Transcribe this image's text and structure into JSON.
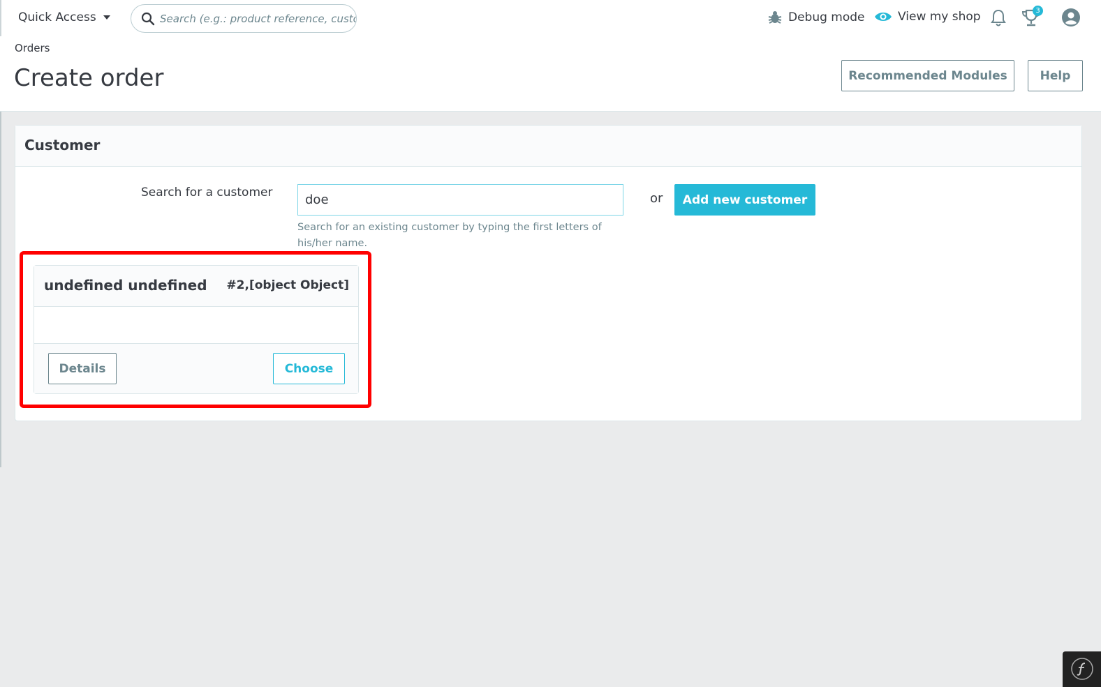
{
  "topbar": {
    "quick_access": "Quick Access",
    "search_placeholder": "Search (e.g.: product reference, customer name…)",
    "debug_mode": "Debug mode",
    "view_shop": "View my shop",
    "notifications_badge": "3"
  },
  "header": {
    "breadcrumb": "Orders",
    "title": "Create order",
    "recommended_modules": "Recommended Modules",
    "help": "Help"
  },
  "customer": {
    "section_title": "Customer",
    "search_label": "Search for a customer",
    "search_value": "doe",
    "or": "or",
    "add_new": "Add new customer",
    "hint": "Search for an existing customer by typing the first letters of his/her name."
  },
  "result": {
    "name": "undefined undefined",
    "id": "#2,[object Object]",
    "details": "Details",
    "choose": "Choose"
  },
  "colors": {
    "accent": "#25b9d7",
    "highlight": "#ff0000",
    "text": "#363a41",
    "muted": "#6c868e"
  },
  "icons": [
    "search-icon",
    "bug-icon",
    "eye-icon",
    "bell-icon",
    "trophy-icon",
    "user-icon",
    "symfony-icon"
  ]
}
